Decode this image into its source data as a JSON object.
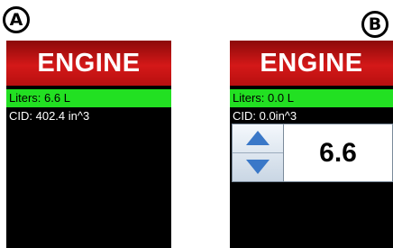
{
  "panels": {
    "a": {
      "badge": "A",
      "title": "ENGINE",
      "rows": [
        {
          "label": "Liters: 6.6 L"
        },
        {
          "label": "CID: 402.4 in^3"
        }
      ]
    },
    "b": {
      "badge": "B",
      "title": "ENGINE",
      "rows": [
        {
          "label": "Liters: 0.0 L"
        },
        {
          "label": "CID: 0.0in^3"
        }
      ],
      "stepper": {
        "value": "6.6",
        "up_icon": "triangle-up-icon",
        "down_icon": "triangle-down-icon"
      }
    }
  },
  "colors": {
    "header_red": "#d41818",
    "selected_green": "#22e022",
    "panel_background": "#000000",
    "stepper_arrow": "#3a78c8"
  }
}
